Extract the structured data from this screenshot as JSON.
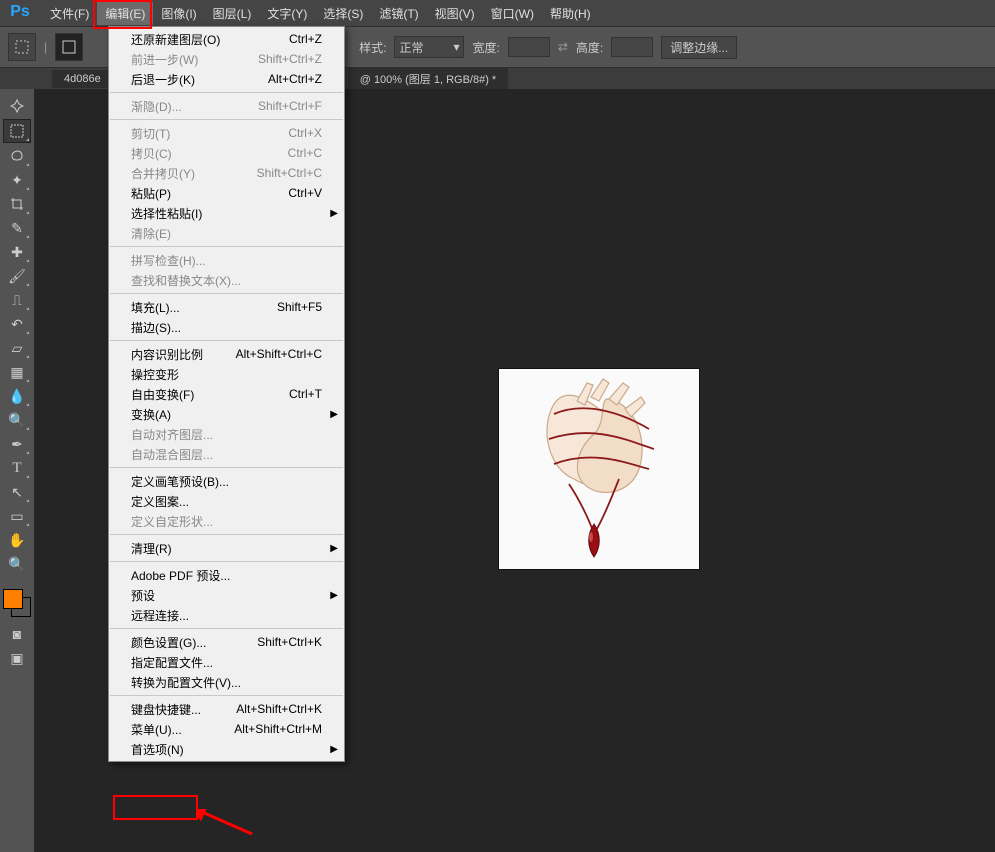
{
  "app": {
    "logo": "Ps"
  },
  "menubar": {
    "items": [
      "文件(F)",
      "编辑(E)",
      "图像(I)",
      "图层(L)",
      "文字(Y)",
      "选择(S)",
      "滤镜(T)",
      "视图(V)",
      "窗口(W)",
      "帮助(H)"
    ]
  },
  "optionsbar": {
    "style_label": "样式:",
    "style_value": "正常",
    "width_label": "宽度:",
    "height_label": "高度:",
    "adjust_edge": "调整边缘..."
  },
  "tab": {
    "left_partial": "4d086e",
    "title": "@ 100% (图层 1, RGB/8#) *"
  },
  "dropdown": {
    "groups": [
      [
        {
          "label": "还原新建图层(O)",
          "shortcut": "Ctrl+Z",
          "enabled": true
        },
        {
          "label": "前进一步(W)",
          "shortcut": "Shift+Ctrl+Z",
          "enabled": false
        },
        {
          "label": "后退一步(K)",
          "shortcut": "Alt+Ctrl+Z",
          "enabled": true
        }
      ],
      [
        {
          "label": "渐隐(D)...",
          "shortcut": "Shift+Ctrl+F",
          "enabled": false
        }
      ],
      [
        {
          "label": "剪切(T)",
          "shortcut": "Ctrl+X",
          "enabled": false
        },
        {
          "label": "拷贝(C)",
          "shortcut": "Ctrl+C",
          "enabled": false
        },
        {
          "label": "合并拷贝(Y)",
          "shortcut": "Shift+Ctrl+C",
          "enabled": false
        },
        {
          "label": "粘贴(P)",
          "shortcut": "Ctrl+V",
          "enabled": true
        },
        {
          "label": "选择性粘贴(I)",
          "shortcut": "",
          "enabled": true,
          "sub": true
        },
        {
          "label": "清除(E)",
          "shortcut": "",
          "enabled": false
        }
      ],
      [
        {
          "label": "拼写检查(H)...",
          "shortcut": "",
          "enabled": false
        },
        {
          "label": "查找和替换文本(X)...",
          "shortcut": "",
          "enabled": false
        }
      ],
      [
        {
          "label": "填充(L)...",
          "shortcut": "Shift+F5",
          "enabled": true
        },
        {
          "label": "描边(S)...",
          "shortcut": "",
          "enabled": true
        }
      ],
      [
        {
          "label": "内容识别比例",
          "shortcut": "Alt+Shift+Ctrl+C",
          "enabled": true
        },
        {
          "label": "操控变形",
          "shortcut": "",
          "enabled": true
        },
        {
          "label": "自由变换(F)",
          "shortcut": "Ctrl+T",
          "enabled": true
        },
        {
          "label": "变换(A)",
          "shortcut": "",
          "enabled": true,
          "sub": true
        },
        {
          "label": "自动对齐图层...",
          "shortcut": "",
          "enabled": false
        },
        {
          "label": "自动混合图层...",
          "shortcut": "",
          "enabled": false
        }
      ],
      [
        {
          "label": "定义画笔预设(B)...",
          "shortcut": "",
          "enabled": true
        },
        {
          "label": "定义图案...",
          "shortcut": "",
          "enabled": true
        },
        {
          "label": "定义自定形状...",
          "shortcut": "",
          "enabled": false
        }
      ],
      [
        {
          "label": "清理(R)",
          "shortcut": "",
          "enabled": true,
          "sub": true
        }
      ],
      [
        {
          "label": "Adobe PDF 预设...",
          "shortcut": "",
          "enabled": true
        },
        {
          "label": "预设",
          "shortcut": "",
          "enabled": true,
          "sub": true
        },
        {
          "label": "远程连接...",
          "shortcut": "",
          "enabled": true
        }
      ],
      [
        {
          "label": "颜色设置(G)...",
          "shortcut": "Shift+Ctrl+K",
          "enabled": true
        },
        {
          "label": "指定配置文件...",
          "shortcut": "",
          "enabled": true
        },
        {
          "label": "转换为配置文件(V)...",
          "shortcut": "",
          "enabled": true
        }
      ],
      [
        {
          "label": "键盘快捷键...",
          "shortcut": "Alt+Shift+Ctrl+K",
          "enabled": true
        },
        {
          "label": "菜单(U)...",
          "shortcut": "Alt+Shift+Ctrl+M",
          "enabled": true
        },
        {
          "label": "首选项(N)",
          "shortcut": "",
          "enabled": true,
          "sub": true
        }
      ]
    ]
  }
}
